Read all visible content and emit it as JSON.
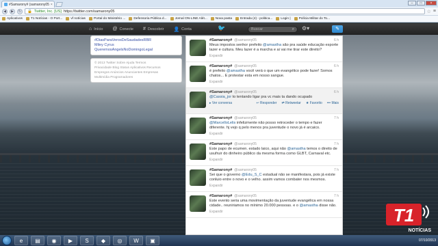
{
  "browser": {
    "tab_title": "#Samarony# (samarony05",
    "tab_close": "×",
    "window_controls": [
      "–",
      "□",
      "×"
    ],
    "url_secure": "Twitter, Inc. [US]",
    "url_path": "https://twitter.com/samarony05",
    "bookmarks": [
      "Aplicativos",
      "T1 Notícias - O Port...",
      "vf notícias",
      "Portal do Ministério ...",
      "Defensoria Pública d...",
      "Jornal ON-LINE Alét...",
      "Nova pasta",
      "Entrada (4) - politica...",
      "Login |",
      "Polícia Militar do To..."
    ]
  },
  "twitter_nav": {
    "home": "Início",
    "connect": "Conecte",
    "discover": "Descobrir",
    "account": "Conta",
    "search_placeholder": "Buscar"
  },
  "sidebar": {
    "trends": [
      "#DiasParaVerosDeSaudadesRBR",
      "Miley Cyrus",
      "QueremosAngelsNoDomingoLegal"
    ],
    "footer_lines": [
      "© 2013 Twitter  Sobre  Ajuda  Termos",
      "Privacidade  Blog  Status  Aplicativos  Recursos",
      "Empregos  Anúncios  Anunciantes  Empresas",
      "Multimídia  Programadores"
    ]
  },
  "tweets": [
    {
      "name": "#Samarony#",
      "handle": "@samarony05",
      "time": "6 h",
      "text_before": "Meus impostos senhor prefeito ",
      "mention": "@amastha",
      "text_after": " são pra saúde educação esporte lazer e cultura. Meu lazer é a marcha e ai vai me tirar este direito?",
      "expand": "Expandir",
      "highlighted": false
    },
    {
      "name": "#Samarony#",
      "handle": "@samarony05",
      "time": "6 h",
      "text_before": "é prefeito ",
      "mention": "@amastha",
      "text_after": " você verá o que um evangélico pode fazer! Somos chatos... E protestar esta em nosso sangue.",
      "expand": "Expandir",
      "highlighted": false
    },
    {
      "name": "#Samarony#",
      "handle": "@samarony05",
      "time": "6 h",
      "text_before": "",
      "mention": "@Cassia_jor",
      "text_after": " to tentando ligar pra vc mais ta dando ocupado",
      "expand": "",
      "highlighted": true,
      "actions": [
        "Ver conversa",
        "Responder",
        "Retweetar",
        "Favorito",
        "Mais"
      ]
    },
    {
      "name": "#Samarony#",
      "handle": "@samarony05",
      "time": "7 h",
      "text_before": "",
      "mention": "@MarcelloLelis",
      "text_after": " infelizmente não posso retroceder o tempo e fazer diferente. hj vejo q pelo menos pra juventude o novo já é arcaico.",
      "expand": "Expandir",
      "highlighted": false
    },
    {
      "name": "#Samarony#",
      "handle": "@samarony05",
      "time": "7 h",
      "text_before": "Este papo de ecumen. estado laico, aqui não ",
      "mention": "@amastha",
      "text_after": " temos o direito de usufruir do dinheiro público da mesma forma como GLBT, Carnaval etc.",
      "expand": "Expandir",
      "highlighted": false
    },
    {
      "name": "#Samarony#",
      "handle": "@samarony05",
      "time": "7 h",
      "text_before": "Sei que o governo ",
      "mention": "@Edu_S_C",
      "text_after": " estadual não se manifestara, pois já existe conluio entre o novo e o velho. assim vamos combater nos mesmos.",
      "expand": "Expandir",
      "highlighted": false
    },
    {
      "name": "#Samarony#",
      "handle": "@samarony05",
      "time": "7 h",
      "text_before": "Este evento seria uma movimentação da juventude evangélica em nossa cidade.. reuniriamos no mínimo 20.000 pessoas. e o ",
      "mention": "@amastha",
      "text_after": " disse não.",
      "expand": "Expandir",
      "highlighted": false
    }
  ],
  "logo": {
    "mark": "T1",
    "word": "NOTÍCIAS"
  },
  "taskbar": {
    "clock_time": "",
    "clock_date": "07/10/2013"
  }
}
